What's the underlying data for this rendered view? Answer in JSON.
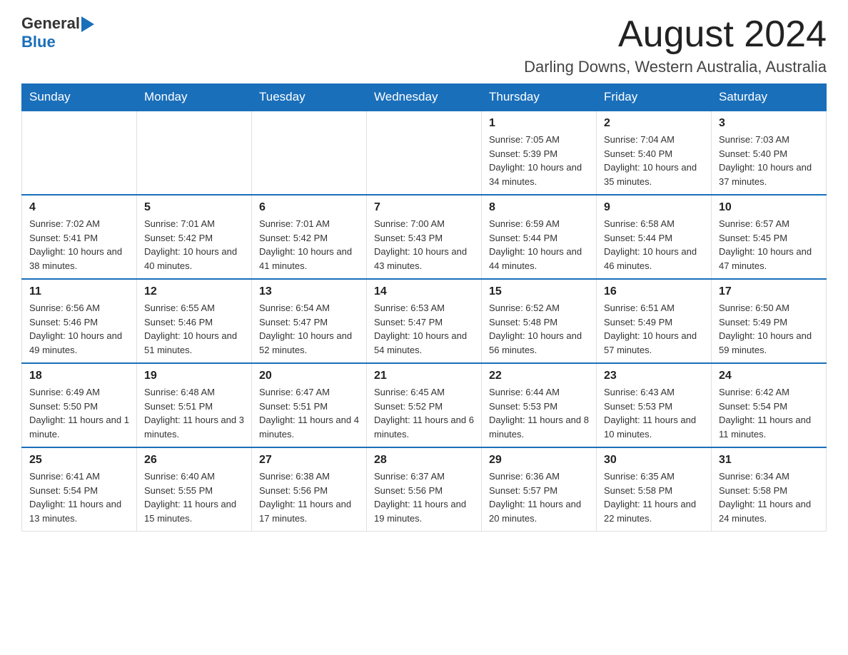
{
  "header": {
    "logo_general": "General",
    "logo_blue": "Blue",
    "month_title": "August 2024",
    "location": "Darling Downs, Western Australia, Australia"
  },
  "days_of_week": [
    "Sunday",
    "Monday",
    "Tuesday",
    "Wednesday",
    "Thursday",
    "Friday",
    "Saturday"
  ],
  "weeks": [
    {
      "days": [
        {
          "number": "",
          "info": ""
        },
        {
          "number": "",
          "info": ""
        },
        {
          "number": "",
          "info": ""
        },
        {
          "number": "",
          "info": ""
        },
        {
          "number": "1",
          "info": "Sunrise: 7:05 AM\nSunset: 5:39 PM\nDaylight: 10 hours and 34 minutes."
        },
        {
          "number": "2",
          "info": "Sunrise: 7:04 AM\nSunset: 5:40 PM\nDaylight: 10 hours and 35 minutes."
        },
        {
          "number": "3",
          "info": "Sunrise: 7:03 AM\nSunset: 5:40 PM\nDaylight: 10 hours and 37 minutes."
        }
      ]
    },
    {
      "days": [
        {
          "number": "4",
          "info": "Sunrise: 7:02 AM\nSunset: 5:41 PM\nDaylight: 10 hours and 38 minutes."
        },
        {
          "number": "5",
          "info": "Sunrise: 7:01 AM\nSunset: 5:42 PM\nDaylight: 10 hours and 40 minutes."
        },
        {
          "number": "6",
          "info": "Sunrise: 7:01 AM\nSunset: 5:42 PM\nDaylight: 10 hours and 41 minutes."
        },
        {
          "number": "7",
          "info": "Sunrise: 7:00 AM\nSunset: 5:43 PM\nDaylight: 10 hours and 43 minutes."
        },
        {
          "number": "8",
          "info": "Sunrise: 6:59 AM\nSunset: 5:44 PM\nDaylight: 10 hours and 44 minutes."
        },
        {
          "number": "9",
          "info": "Sunrise: 6:58 AM\nSunset: 5:44 PM\nDaylight: 10 hours and 46 minutes."
        },
        {
          "number": "10",
          "info": "Sunrise: 6:57 AM\nSunset: 5:45 PM\nDaylight: 10 hours and 47 minutes."
        }
      ]
    },
    {
      "days": [
        {
          "number": "11",
          "info": "Sunrise: 6:56 AM\nSunset: 5:46 PM\nDaylight: 10 hours and 49 minutes."
        },
        {
          "number": "12",
          "info": "Sunrise: 6:55 AM\nSunset: 5:46 PM\nDaylight: 10 hours and 51 minutes."
        },
        {
          "number": "13",
          "info": "Sunrise: 6:54 AM\nSunset: 5:47 PM\nDaylight: 10 hours and 52 minutes."
        },
        {
          "number": "14",
          "info": "Sunrise: 6:53 AM\nSunset: 5:47 PM\nDaylight: 10 hours and 54 minutes."
        },
        {
          "number": "15",
          "info": "Sunrise: 6:52 AM\nSunset: 5:48 PM\nDaylight: 10 hours and 56 minutes."
        },
        {
          "number": "16",
          "info": "Sunrise: 6:51 AM\nSunset: 5:49 PM\nDaylight: 10 hours and 57 minutes."
        },
        {
          "number": "17",
          "info": "Sunrise: 6:50 AM\nSunset: 5:49 PM\nDaylight: 10 hours and 59 minutes."
        }
      ]
    },
    {
      "days": [
        {
          "number": "18",
          "info": "Sunrise: 6:49 AM\nSunset: 5:50 PM\nDaylight: 11 hours and 1 minute."
        },
        {
          "number": "19",
          "info": "Sunrise: 6:48 AM\nSunset: 5:51 PM\nDaylight: 11 hours and 3 minutes."
        },
        {
          "number": "20",
          "info": "Sunrise: 6:47 AM\nSunset: 5:51 PM\nDaylight: 11 hours and 4 minutes."
        },
        {
          "number": "21",
          "info": "Sunrise: 6:45 AM\nSunset: 5:52 PM\nDaylight: 11 hours and 6 minutes."
        },
        {
          "number": "22",
          "info": "Sunrise: 6:44 AM\nSunset: 5:53 PM\nDaylight: 11 hours and 8 minutes."
        },
        {
          "number": "23",
          "info": "Sunrise: 6:43 AM\nSunset: 5:53 PM\nDaylight: 11 hours and 10 minutes."
        },
        {
          "number": "24",
          "info": "Sunrise: 6:42 AM\nSunset: 5:54 PM\nDaylight: 11 hours and 11 minutes."
        }
      ]
    },
    {
      "days": [
        {
          "number": "25",
          "info": "Sunrise: 6:41 AM\nSunset: 5:54 PM\nDaylight: 11 hours and 13 minutes."
        },
        {
          "number": "26",
          "info": "Sunrise: 6:40 AM\nSunset: 5:55 PM\nDaylight: 11 hours and 15 minutes."
        },
        {
          "number": "27",
          "info": "Sunrise: 6:38 AM\nSunset: 5:56 PM\nDaylight: 11 hours and 17 minutes."
        },
        {
          "number": "28",
          "info": "Sunrise: 6:37 AM\nSunset: 5:56 PM\nDaylight: 11 hours and 19 minutes."
        },
        {
          "number": "29",
          "info": "Sunrise: 6:36 AM\nSunset: 5:57 PM\nDaylight: 11 hours and 20 minutes."
        },
        {
          "number": "30",
          "info": "Sunrise: 6:35 AM\nSunset: 5:58 PM\nDaylight: 11 hours and 22 minutes."
        },
        {
          "number": "31",
          "info": "Sunrise: 6:34 AM\nSunset: 5:58 PM\nDaylight: 11 hours and 24 minutes."
        }
      ]
    }
  ]
}
